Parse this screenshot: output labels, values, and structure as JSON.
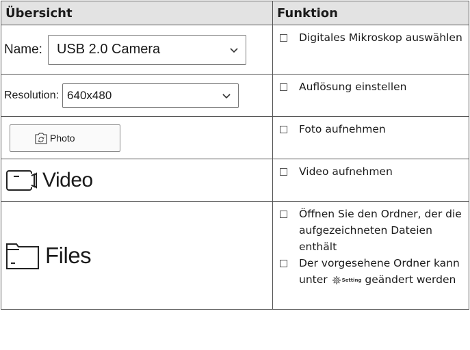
{
  "header": {
    "col_overview": "Übersicht",
    "col_function": "Funktion"
  },
  "rows": {
    "name": {
      "label": "Name:",
      "value": "USB 2.0 Camera",
      "func": [
        "Digitales Mikroskop auswählen"
      ]
    },
    "resolution": {
      "label": "Resolution:",
      "value": "640x480",
      "func": [
        "Auflösung einstellen"
      ]
    },
    "photo": {
      "label": "Photo",
      "func": [
        "Foto aufnehmen"
      ]
    },
    "video": {
      "label": "Video",
      "func": [
        "Video aufnehmen"
      ]
    },
    "files": {
      "label": "Files",
      "func1": "Öffnen Sie den Ordner, der die aufgezeichneten Dateien enthält",
      "func2_pre": "Der vorgesehene Ordner kann unter",
      "func2_setting": "Setting",
      "func2_post": "geändert werden"
    }
  },
  "icons": {
    "photo": "camera-rotate-icon",
    "video": "video-camera-icon",
    "files": "folder-icon",
    "setting": "gear-icon",
    "dropdown": "chevron-down-icon",
    "bullet": "checkbox-icon"
  }
}
